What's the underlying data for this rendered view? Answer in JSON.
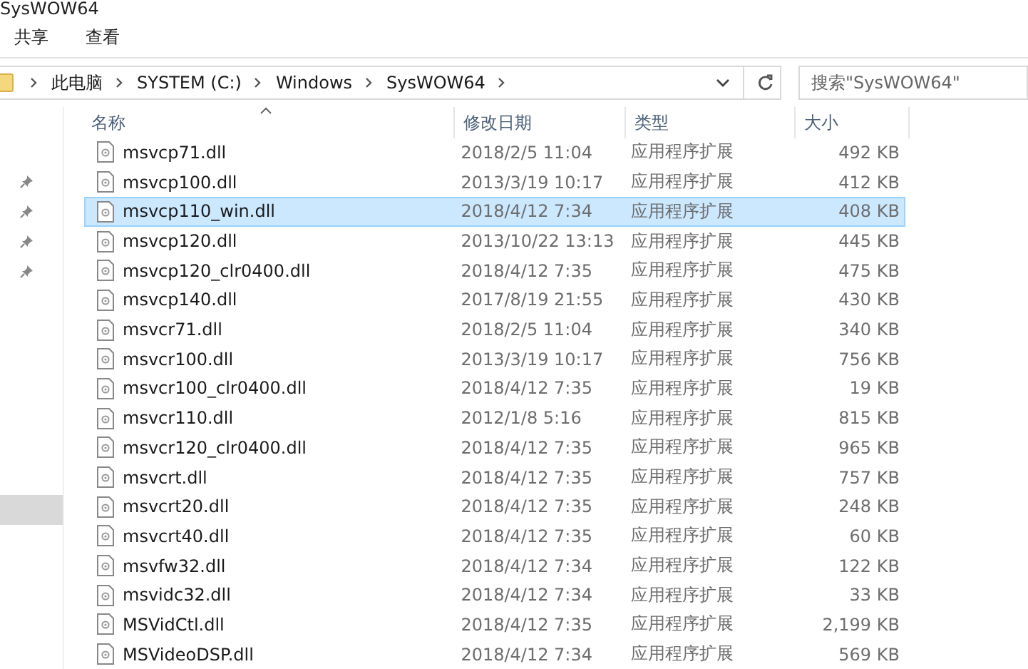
{
  "window": {
    "title": "SysWOW64"
  },
  "ribbon_tabs": [
    {
      "label": "共享",
      "selected": false
    },
    {
      "label": "查看",
      "selected": false
    }
  ],
  "address_bar": {
    "path": [
      "此电脑",
      "SYSTEM (C:)",
      "Windows",
      "SysWOW64"
    ]
  },
  "search": {
    "placeholder": "搜索\"SysWOW64\""
  },
  "sidebar": {
    "items": [
      {
        "pinned": false,
        "selected": false
      },
      {
        "pinned": true,
        "selected": false
      },
      {
        "pinned": true,
        "selected": false
      },
      {
        "pinned": true,
        "selected": false
      },
      {
        "pinned": true,
        "selected": false
      },
      {
        "pinned": false,
        "selected": false
      },
      {
        "pinned": false,
        "selected": false
      },
      {
        "pinned": false,
        "selected": false
      },
      {
        "pinned": false,
        "selected": false
      },
      {
        "pinned": false,
        "selected": false
      },
      {
        "pinned": false,
        "selected": false
      },
      {
        "pinned": false,
        "selected": false
      },
      {
        "pinned": false,
        "selected": true
      }
    ]
  },
  "table": {
    "columns": [
      {
        "label": "名称",
        "sorted": true
      },
      {
        "label": "修改日期",
        "sorted": false
      },
      {
        "label": "类型",
        "sorted": false
      },
      {
        "label": "大小",
        "sorted": false
      }
    ],
    "rows": [
      {
        "name": "msvcp71.dll",
        "date": "2018/2/5 11:04",
        "type": "应用程序扩展",
        "size": "492 KB",
        "selected": false
      },
      {
        "name": "msvcp100.dll",
        "date": "2013/3/19 10:17",
        "type": "应用程序扩展",
        "size": "412 KB",
        "selected": false
      },
      {
        "name": "msvcp110_win.dll",
        "date": "2018/4/12 7:34",
        "type": "应用程序扩展",
        "size": "408 KB",
        "selected": true
      },
      {
        "name": "msvcp120.dll",
        "date": "2013/10/22 13:13",
        "type": "应用程序扩展",
        "size": "445 KB",
        "selected": false
      },
      {
        "name": "msvcp120_clr0400.dll",
        "date": "2018/4/12 7:35",
        "type": "应用程序扩展",
        "size": "475 KB",
        "selected": false
      },
      {
        "name": "msvcp140.dll",
        "date": "2017/8/19 21:55",
        "type": "应用程序扩展",
        "size": "430 KB",
        "selected": false
      },
      {
        "name": "msvcr71.dll",
        "date": "2018/2/5 11:04",
        "type": "应用程序扩展",
        "size": "340 KB",
        "selected": false
      },
      {
        "name": "msvcr100.dll",
        "date": "2013/3/19 10:17",
        "type": "应用程序扩展",
        "size": "756 KB",
        "selected": false
      },
      {
        "name": "msvcr100_clr0400.dll",
        "date": "2018/4/12 7:35",
        "type": "应用程序扩展",
        "size": "19 KB",
        "selected": false
      },
      {
        "name": "msvcr110.dll",
        "date": "2012/1/8 5:16",
        "type": "应用程序扩展",
        "size": "815 KB",
        "selected": false
      },
      {
        "name": "msvcr120_clr0400.dll",
        "date": "2018/4/12 7:35",
        "type": "应用程序扩展",
        "size": "965 KB",
        "selected": false
      },
      {
        "name": "msvcrt.dll",
        "date": "2018/4/12 7:35",
        "type": "应用程序扩展",
        "size": "757 KB",
        "selected": false
      },
      {
        "name": "msvcrt20.dll",
        "date": "2018/4/12 7:35",
        "type": "应用程序扩展",
        "size": "248 KB",
        "selected": false
      },
      {
        "name": "msvcrt40.dll",
        "date": "2018/4/12 7:35",
        "type": "应用程序扩展",
        "size": "60 KB",
        "selected": false
      },
      {
        "name": "msvfw32.dll",
        "date": "2018/4/12 7:34",
        "type": "应用程序扩展",
        "size": "122 KB",
        "selected": false
      },
      {
        "name": "msvidc32.dll",
        "date": "2018/4/12 7:34",
        "type": "应用程序扩展",
        "size": "33 KB",
        "selected": false
      },
      {
        "name": "MSVidCtl.dll",
        "date": "2018/4/12 7:35",
        "type": "应用程序扩展",
        "size": "2,199 KB",
        "selected": false
      },
      {
        "name": "MSVideoDSP.dll",
        "date": "2018/4/12 7:34",
        "type": "应用程序扩展",
        "size": "569 KB",
        "selected": false
      }
    ]
  }
}
